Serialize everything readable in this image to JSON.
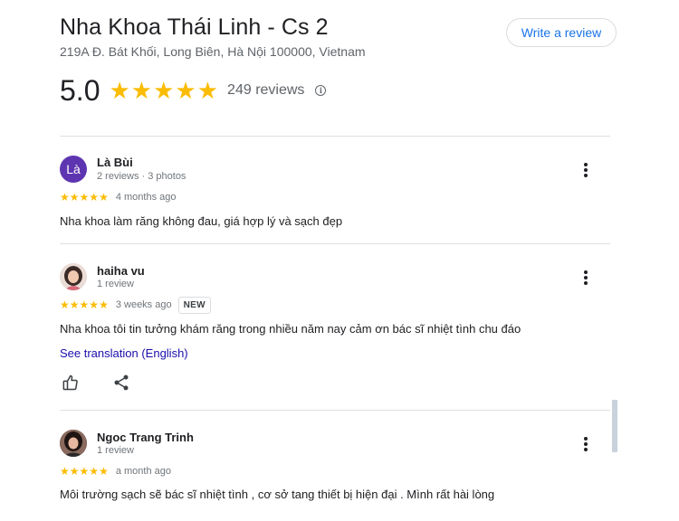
{
  "place": {
    "name": "Nha Khoa Thái Linh - Cs 2",
    "address": "219A Đ. Bát Khối, Long Biên, Hà Nội 100000, Vietnam",
    "rating": "5.0",
    "stars": 5,
    "review_count": "249 reviews",
    "write_review_label": "Write a review"
  },
  "colors": {
    "star": "#fbbc04",
    "link": "#1a0dab",
    "accent": "#1a73e8",
    "avatar_la": "#5e35b1"
  },
  "reviews": [
    {
      "author": "Là Bùi",
      "avatar_letter": "Là",
      "meta": "2 reviews · 3 photos",
      "stars": 5,
      "date": "4 months ago",
      "text": "Nha khoa làm răng không đau, giá hợp lý và sạch đẹp"
    },
    {
      "author": "haiha vu",
      "meta": "1 review",
      "stars": 5,
      "date": "3 weeks ago",
      "badge": "NEW",
      "text": "Nha khoa tôi tin tưởng khám răng trong nhiều năm nay cảm ơn bác sĩ nhiệt tình chu đáo",
      "translation_link": "See translation (English)"
    },
    {
      "author": "Ngoc Trang Trinh",
      "meta": "1 review",
      "stars": 5,
      "date": "a month ago",
      "text": "Môi trường sạch sẽ bác sĩ nhiệt tình , cơ sở tang thiết bị hiện đại . Mình rất hài lòng"
    }
  ],
  "icons": {
    "info": "info-icon",
    "more": "more-vert-icon",
    "like": "thumbs-up-icon",
    "share": "share-icon"
  }
}
